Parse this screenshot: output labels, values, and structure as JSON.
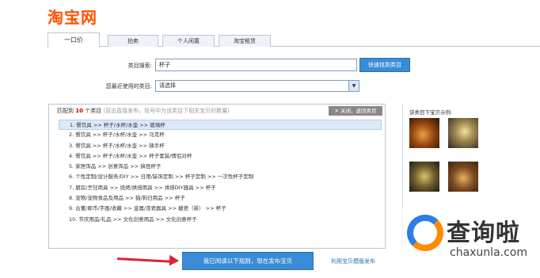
{
  "logo": "淘宝网",
  "tabs": [
    "一口价",
    "拍卖",
    "个人闲置",
    "淘宝租赁"
  ],
  "search": {
    "label": "类目搜索:",
    "value": "杯子",
    "button": "快速找到类目"
  },
  "recent": {
    "label": "您最近使用的类目:",
    "selected": "请选择"
  },
  "results": {
    "prefix": "匹配到",
    "count": "10",
    "suffix": "个类目",
    "hint": "(双击直接发布，括号中为该类目下相关宝贝的数量)",
    "close_button": "关闭，返回类目",
    "items": [
      "1.  餐饮具 >> 杯子/水杯/水壶 >> 玻璃杯",
      "2.  餐饮具 >> 杯子/水杯/水壶 >> 马克杯",
      "3.  餐饮具 >> 杯子/水杯/水壶 >> 随手杯",
      "4.  餐饮具 >> 杯子/水杯/水壶 >> 杯子套装/情侣对杯",
      "5.  家居饰品 >> 创意饰品 >> 搞怪杯子",
      "6.  个性定制/设计服务/DIY >> 日用/装饰定制 >> 杯子定制 >> 一次性杯子定制",
      "7.  厨房/烹饪用具 >> 烧烤/烘焙用具 >> 烘焙DIY器具 >> 杯子",
      "8.  宠物/宠物食品及用品 >> 猫/狗日用品 >> 杯子",
      "9.  古董/邮币/字画/收藏 >> 金属/漆瓷器具 >> 搪瓷（新） >> 杯子",
      "10.  节庆用品/礼品 >> 文化创意用品 >> 文化创意杯子"
    ]
  },
  "side": {
    "title": "该类目下宝贝示例:"
  },
  "submit_button": "我已阅读以下规则，现在发布宝贝",
  "alt_link": "利用宝贝模版发布",
  "watermark": {
    "text": "查询啦",
    "url": "chaxunla.com"
  }
}
